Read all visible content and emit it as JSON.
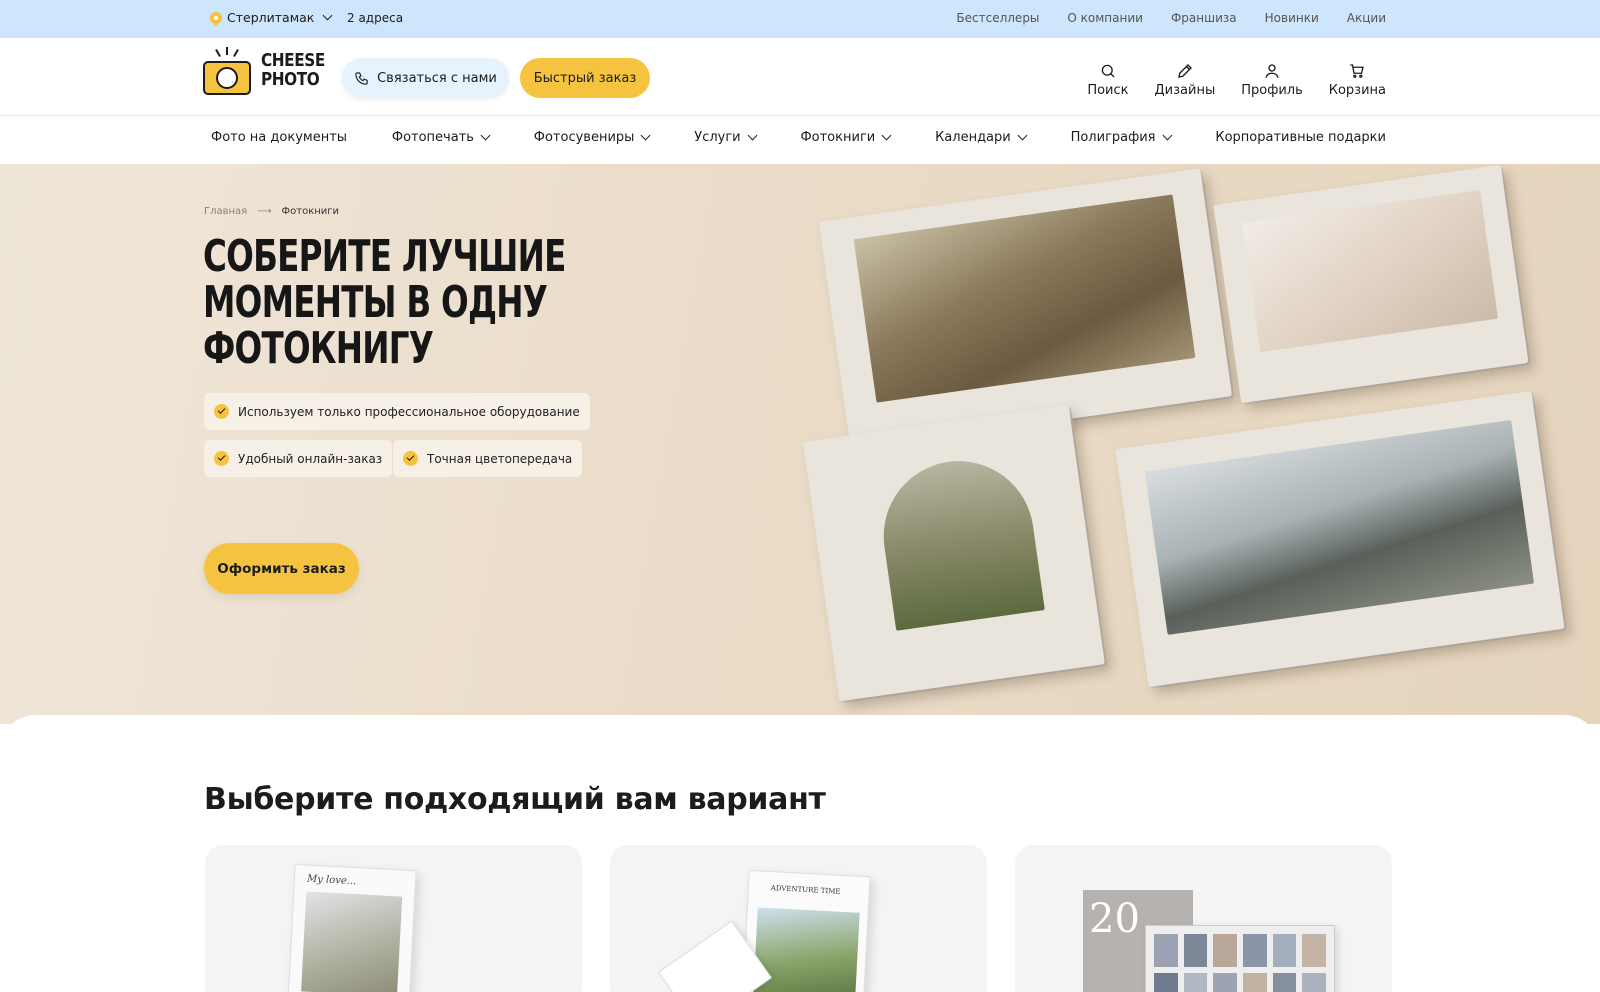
{
  "topbar": {
    "city": "Стерлитамак",
    "addresses": "2 адреса",
    "links": [
      "Бестселлеры",
      "О компании",
      "Франшиза",
      "Новинки",
      "Акции"
    ]
  },
  "header": {
    "logo_line1": "CHEESE",
    "logo_line2": "PHOTO",
    "contact_label": "Связаться с нами",
    "quick_order_label": "Быстрый заказ",
    "icons": {
      "search": "Поиск",
      "designs": "Дизайны",
      "profile": "Профиль",
      "cart": "Корзина"
    }
  },
  "nav": {
    "items": [
      "Фото на документы",
      "Фотопечать",
      "Фотосувениры",
      "Услуги",
      "Фотокниги",
      "Календари",
      "Полиграфия",
      "Корпоративные подарки"
    ]
  },
  "hero": {
    "breadcrumbs": [
      "Главная",
      "Фотокниги"
    ],
    "title_line1": "СОБЕРИТЕ ЛУЧШИЕ",
    "title_line2": "МОМЕНТЫ В ОДНУ",
    "title_line3": "ФОТОКНИГУ",
    "features": [
      "Используем только профессиональное оборудование",
      "Удобный онлайн-заказ",
      "Точная цветопередача"
    ],
    "order_button": "Оформить заказ"
  },
  "section": {
    "title": "Выберите подходящий вам вариант",
    "card_texts": [
      "My love...",
      "ADVENTURE TIME",
      "20"
    ]
  },
  "colors": {
    "accent": "#f5c340",
    "topbar": "#cde6fb",
    "hero_bg": "#eadcc8"
  }
}
